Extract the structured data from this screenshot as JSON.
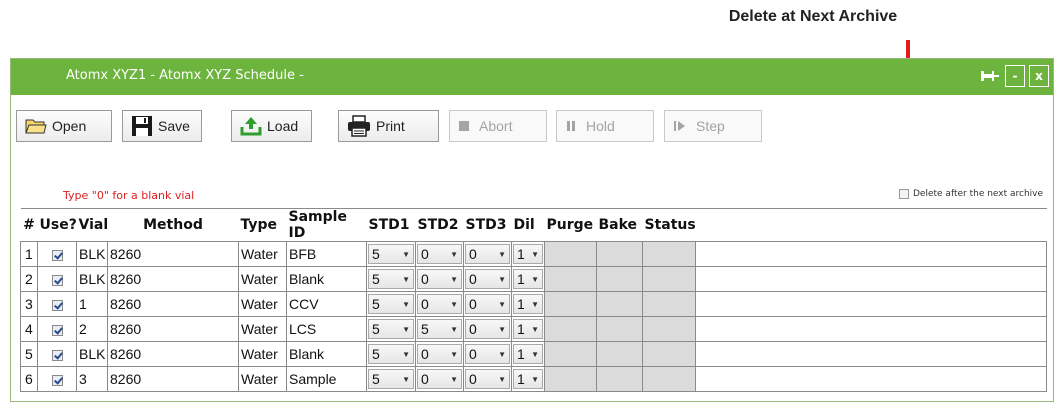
{
  "annotation": {
    "callout": "Delete at Next Archive",
    "arrow_color": "#e21b1b"
  },
  "window": {
    "title": "Atomx XYZ1 - Atomx XYZ  Schedule -",
    "title_color": "#6db43e",
    "minimize_label": "-",
    "close_label": "x"
  },
  "toolbar": {
    "open": "Open",
    "save": "Save",
    "load": "Load",
    "print": "Print",
    "abort": "Abort",
    "hold": "Hold",
    "step": "Step"
  },
  "hint": "Type \"0\" for a blank vial",
  "delete_archive_label": "Delete after the next archive",
  "columns": [
    "#",
    "Use?",
    "Vial",
    "Method",
    "Type",
    "Sample ID",
    "STD1",
    "STD2",
    "STD3",
    "Dil",
    "Purge",
    "Bake",
    "Status"
  ],
  "rows": [
    {
      "num": "1",
      "use": true,
      "vial": "BLK",
      "method": "8260",
      "type": "Water",
      "sample_id": "BFB",
      "std1": "5",
      "std2": "0",
      "std3": "0",
      "dil": "1"
    },
    {
      "num": "2",
      "use": true,
      "vial": "BLK",
      "method": "8260",
      "type": "Water",
      "sample_id": "Blank",
      "std1": "5",
      "std2": "0",
      "std3": "0",
      "dil": "1"
    },
    {
      "num": "3",
      "use": true,
      "vial": "1",
      "method": "8260",
      "type": "Water",
      "sample_id": "CCV",
      "std1": "5",
      "std2": "0",
      "std3": "0",
      "dil": "1"
    },
    {
      "num": "4",
      "use": true,
      "vial": "2",
      "method": "8260",
      "type": "Water",
      "sample_id": "LCS",
      "std1": "5",
      "std2": "5",
      "std3": "0",
      "dil": "1"
    },
    {
      "num": "5",
      "use": true,
      "vial": "BLK",
      "method": "8260",
      "type": "Water",
      "sample_id": "Blank",
      "std1": "5",
      "std2": "0",
      "std3": "0",
      "dil": "1"
    },
    {
      "num": "6",
      "use": true,
      "vial": "3",
      "method": "8260",
      "type": "Water",
      "sample_id": "Sample",
      "std1": "5",
      "std2": "0",
      "std3": "0",
      "dil": "1"
    }
  ]
}
